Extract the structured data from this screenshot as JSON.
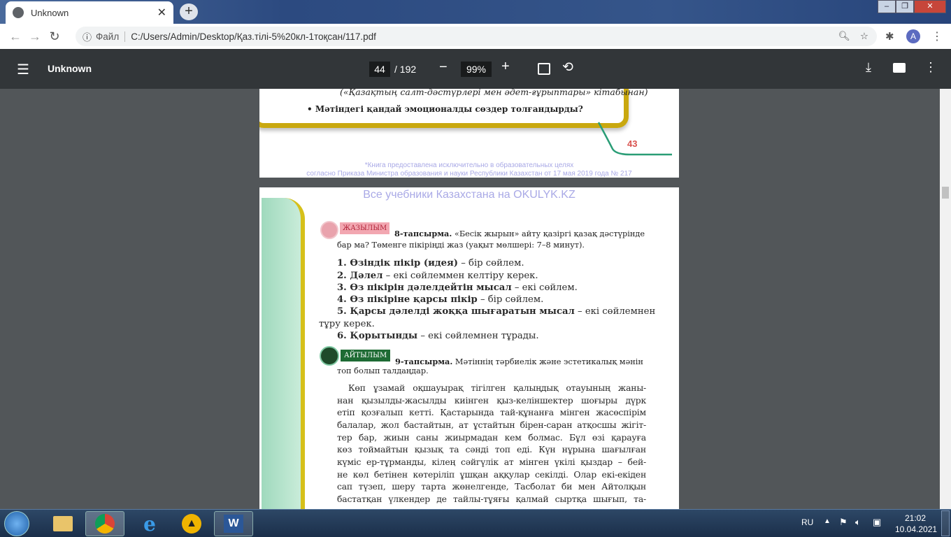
{
  "browser": {
    "tab_title": "Unknown",
    "file_label": "Файл",
    "url": "C:/Users/Admin/Desktop/Қаз.тілі-5%20кл-1тоқсан/117.pdf",
    "profile_initial": "A"
  },
  "pdf_toolbar": {
    "title": "Unknown",
    "current_page": "44",
    "total_pages": "/ 192",
    "zoom": "99%"
  },
  "page1": {
    "citation": "(«Қазақтың салт-дәстүрлері мен әдет-ғұрыптары» кітабынан)",
    "question": "• Мәтіндегі қандай эмоционалды сөздер толғандырды?",
    "page_number": "43",
    "footer_line1": "*Книга предоставлена исключительно в образовательных целях",
    "footer_line2": "согласно Приказа Министра образования и науки Республики Казахстан от 17 мая 2019 года № 217"
  },
  "page2": {
    "watermark": "Все учебники Казахстана на OKULYK.KZ",
    "badge1": "ЖАЗЫЛЫМ",
    "task8_title": "8-тапсырма.",
    "task8_line1": "«Бесік жырын» айту қазіргі қазақ дәстүрінде",
    "task8_line2": "бар ма? Төменге пікіріңді жаз (уақыт мөлшері: 7–8 минут).",
    "items": [
      {
        "bold": "1. Өзіндік пікір (идея)",
        "rest": " – бір сөйлем."
      },
      {
        "bold": "2. Дәлел",
        "rest": " – екі сөйлеммен келтіру керек."
      },
      {
        "bold": "3. Өз пікірін дәлелдейтін мысал",
        "rest": " – екі сөйлем."
      },
      {
        "bold": "4. Өз пікіріне қарсы пікір",
        "rest": " – бір сөйлем."
      },
      {
        "bold": "5. Қарсы дәлелді жоққа шығаратын мысал",
        "rest": " – екі сөйлемнен"
      },
      {
        "bold": "",
        "rest": "тұру керек."
      },
      {
        "bold": "6. Қорытынды",
        "rest": " – екі сөйлемнен тұрады."
      }
    ],
    "badge2": "АЙТЫЛЫМ",
    "task9_title": "9-тапсырма.",
    "task9_line1": "Мәтіннің тәрбиелік және эстетикалық мәнін",
    "task9_line2": "топ болып талдаңдар.",
    "paragraph": [
      "Көп ұзамай оқшауырақ тігілген қалыңдық отауының жаны-",
      "нан қызылды-жасылды киінген қыз-келіншектер шоғыры дүрк",
      "етіп қозғалып кетті. Қастарында тай-құнанға мінген жасөспірім",
      "балалар, жол бастайтын, ат ұстайтын бірен-саран атқосшы жігіт-",
      "тер бар, жиын саны жиырмадан кем болмас. Бұл өзі қарауға",
      "көз тоймайтын қызық та сәнді топ еді. Күн нұрына шағылған",
      "күміс ер-тұрманды, кілең сәйгүлік ат мінген үкілі қыздар – бей-",
      "не көл бетінен көтеріліп ұшқан аққулар секілді. Олар екі-екіден",
      "сап түзеп, шеру тарта жөнелгенде, Тасболат би мен Айтолқын",
      "бастатқан үлкендер де тайлы-тұяғы қалмай сыртқа шығып, та-"
    ]
  },
  "taskbar": {
    "language": "RU",
    "time": "21:02",
    "date": "10.04.2021"
  }
}
